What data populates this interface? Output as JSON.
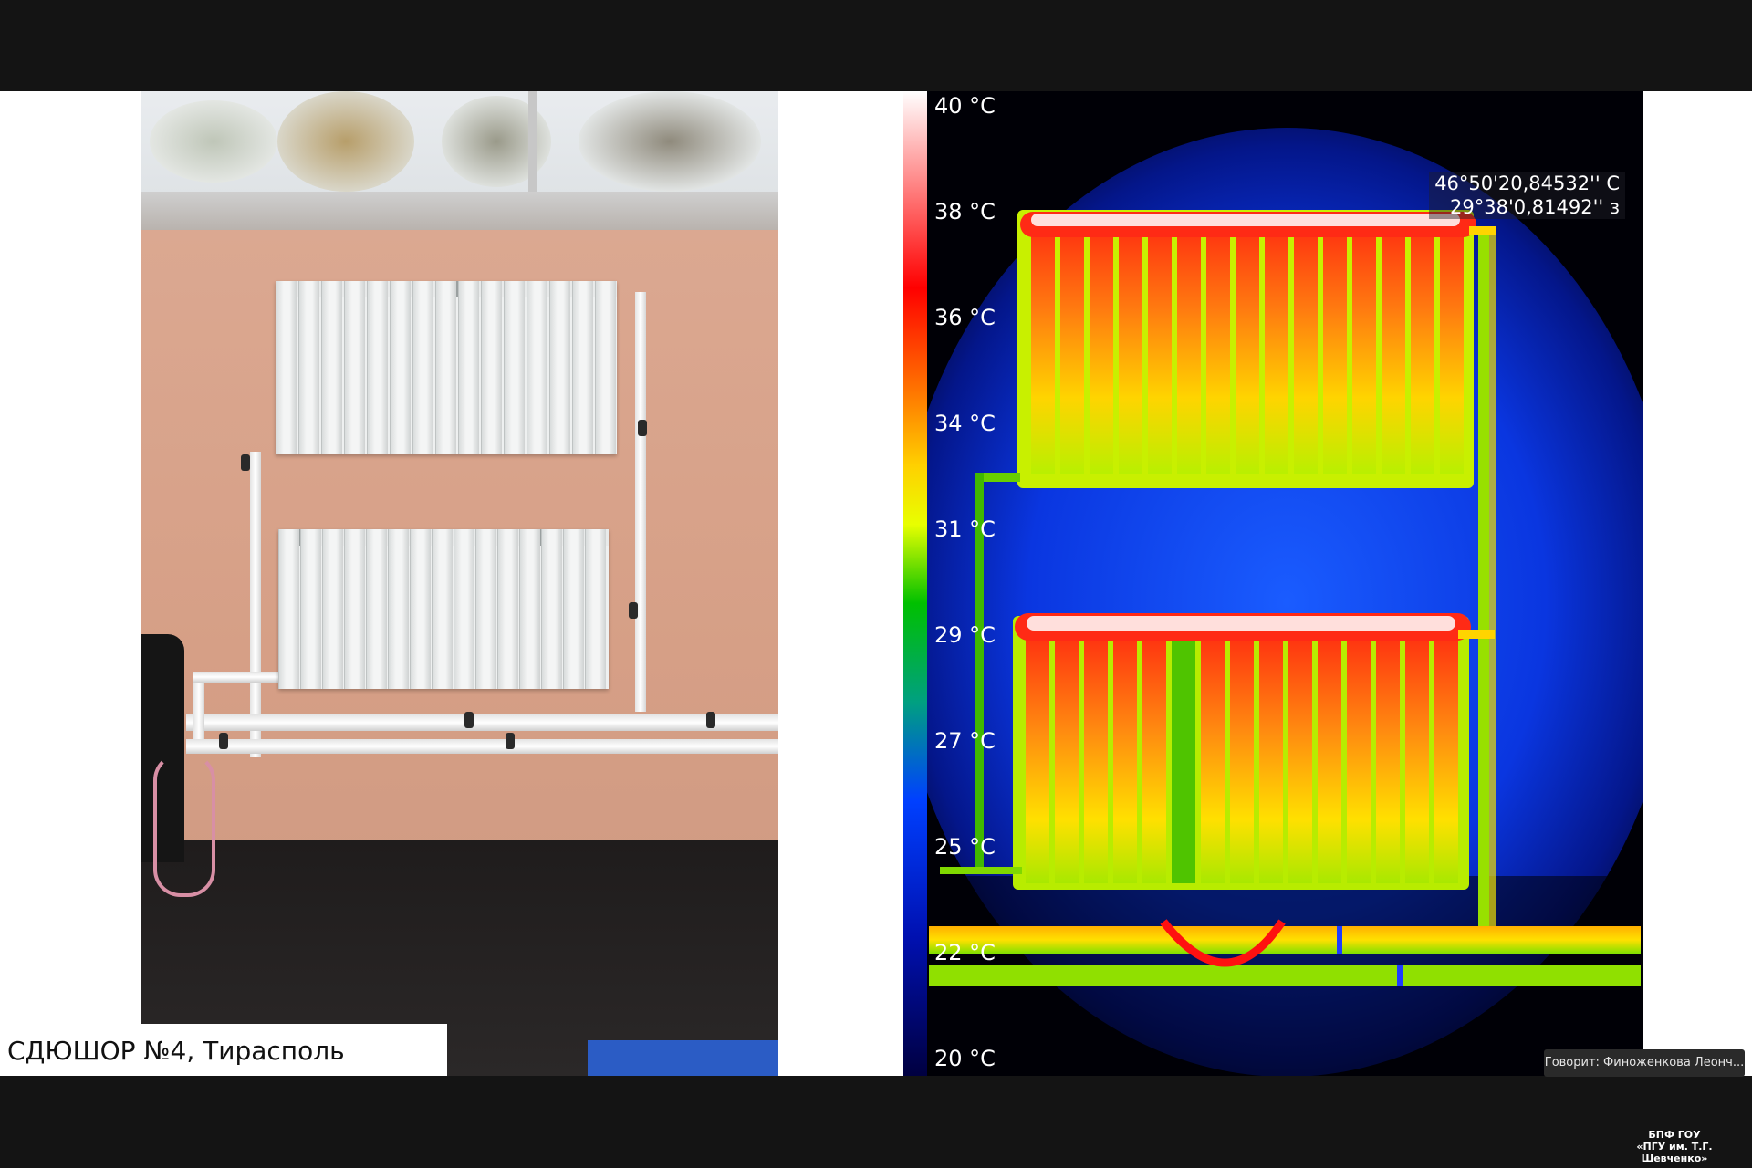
{
  "slide": {
    "caption": "СДЮШОР №4, Тирасполь"
  },
  "thermal": {
    "scale_labels": [
      "40 °C",
      "38 °C",
      "36 °C",
      "34 °C",
      "31 °C",
      "29 °C",
      "27 °C",
      "25 °C",
      "22 °C",
      "20 °C"
    ],
    "gps_lat": "46°50'20,84532'' С",
    "gps_lon": "29°38'0,81492'' з",
    "palette": [
      "#ffffff",
      "#ff0000",
      "#ff8800",
      "#ffff00",
      "#00cc00",
      "#0044ff",
      "#000066"
    ]
  },
  "footer": {
    "speaker": "Говорит: Финоженкова Леонч...",
    "org_line1": "БПФ ГОУ",
    "org_line2": "«ПГУ им. Т.Г. Шевченко»"
  }
}
